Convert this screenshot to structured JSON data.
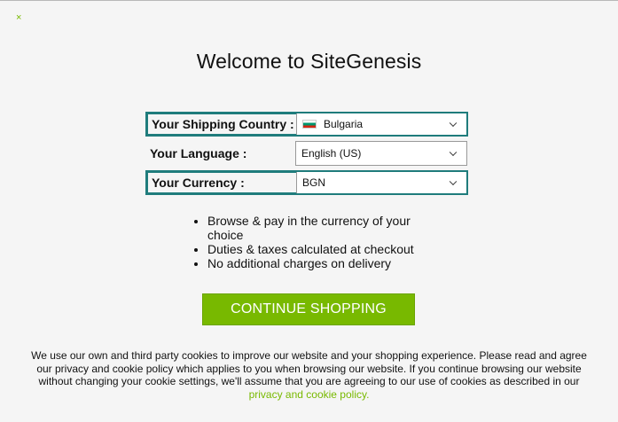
{
  "close_symbol": "×",
  "title": "Welcome to SiteGenesis",
  "form": {
    "shipping_country": {
      "label": "Your Shipping Country :",
      "value": "Bulgaria",
      "flag_icon": "bulgaria-flag-icon"
    },
    "language": {
      "label": "Your Language :",
      "value": "English (US)"
    },
    "currency": {
      "label": "Your Currency :",
      "value": "BGN"
    }
  },
  "benefits": [
    "Browse & pay in the currency of your choice",
    "Duties & taxes calculated at checkout",
    "No additional charges on delivery"
  ],
  "cta_label": "CONTINUE SHOPPING",
  "cookie_notice": {
    "text": "We use our own and third party cookies to improve our website and your shopping experience. Please read and agree our privacy and cookie policy which applies to you when browsing our website. If you continue browsing our website without changing your cookie settings, we'll assume that you are agreeing to our use of cookies as described in our ",
    "link_text": "privacy and cookie policy."
  },
  "colors": {
    "accent": "#78b900",
    "highlight_border": "#1f7c7c"
  }
}
